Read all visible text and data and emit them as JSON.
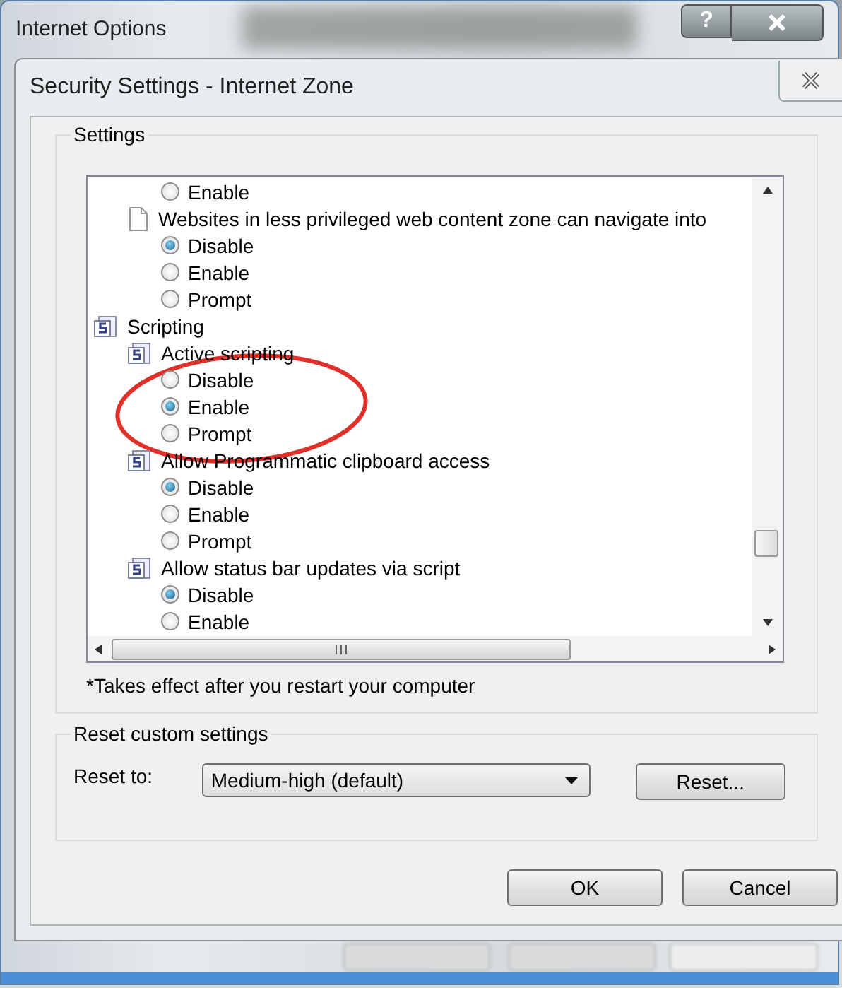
{
  "outer_window": {
    "title": "Internet Options",
    "help_button": "?"
  },
  "dialog": {
    "title": "Security Settings - Internet Zone"
  },
  "settings_group": {
    "label": "Settings",
    "tree": [
      {
        "kind": "continued",
        "children": [
          {
            "kind": "continued",
            "children": [
              {
                "kind": "option",
                "label": "Enable",
                "selected": false
              }
            ]
          },
          {
            "kind": "document-setting",
            "label": "Websites in less privileged web content zone can navigate into",
            "children": [
              {
                "kind": "option",
                "label": "Disable",
                "selected": true
              },
              {
                "kind": "option",
                "label": "Enable",
                "selected": false
              },
              {
                "kind": "option",
                "label": "Prompt",
                "selected": false
              }
            ]
          }
        ]
      },
      {
        "kind": "category",
        "label": "Scripting",
        "children": [
          {
            "kind": "script-setting",
            "label": "Active scripting",
            "children": [
              {
                "kind": "option",
                "label": "Disable",
                "selected": false
              },
              {
                "kind": "option",
                "label": "Enable",
                "selected": true
              },
              {
                "kind": "option",
                "label": "Prompt",
                "selected": false
              }
            ]
          },
          {
            "kind": "script-setting",
            "label": "Allow Programmatic clipboard access",
            "children": [
              {
                "kind": "option",
                "label": "Disable",
                "selected": true
              },
              {
                "kind": "option",
                "label": "Enable",
                "selected": false
              },
              {
                "kind": "option",
                "label": "Prompt",
                "selected": false
              }
            ]
          },
          {
            "kind": "script-setting",
            "label": "Allow status bar updates via script",
            "children": [
              {
                "kind": "option",
                "label": "Disable",
                "selected": true
              },
              {
                "kind": "option",
                "label": "Enable",
                "selected": false
              }
            ]
          }
        ]
      }
    ],
    "note": "*Takes effect after you restart your computer"
  },
  "reset_group": {
    "label": "Reset custom settings",
    "reset_to_label": "Reset to:",
    "level": "Medium-high (default)",
    "reset_button": "Reset..."
  },
  "buttons": [
    {
      "label": "OK"
    },
    {
      "label": "Cancel"
    }
  ]
}
